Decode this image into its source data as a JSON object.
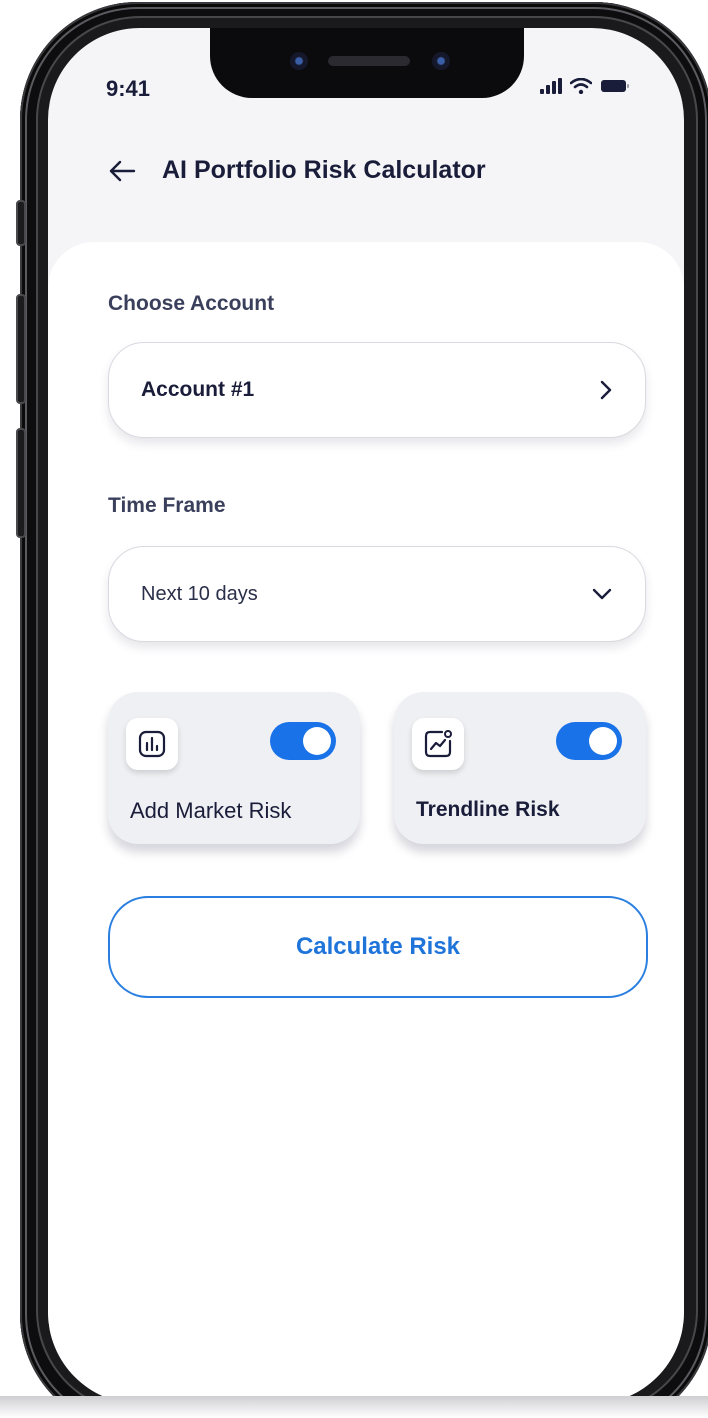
{
  "status_bar": {
    "time": "9:41",
    "icons": [
      "signal-icon",
      "wifi-icon",
      "battery-icon"
    ]
  },
  "header": {
    "back_icon": "back-arrow-icon",
    "title": "AI Portfolio Risk Calculator"
  },
  "account": {
    "label": "Choose Account",
    "value": "Account #1",
    "icon": "chevron-right-icon"
  },
  "time_frame": {
    "label": "Time Frame",
    "value": "Next 10 days",
    "icon": "chevron-down-icon"
  },
  "risk_options": [
    {
      "label": "Add Market Risk",
      "icon": "bar-chart-icon",
      "enabled": true
    },
    {
      "label": "Trendline Risk",
      "icon": "trend-chart-icon",
      "enabled": true
    }
  ],
  "calculate_button": {
    "label": "Calculate Risk"
  },
  "colors": {
    "accent": "#1a72e8",
    "text_dark": "#1a1d3a",
    "button_text": "#1f74da",
    "screen_bg": "#f5f5f7"
  }
}
